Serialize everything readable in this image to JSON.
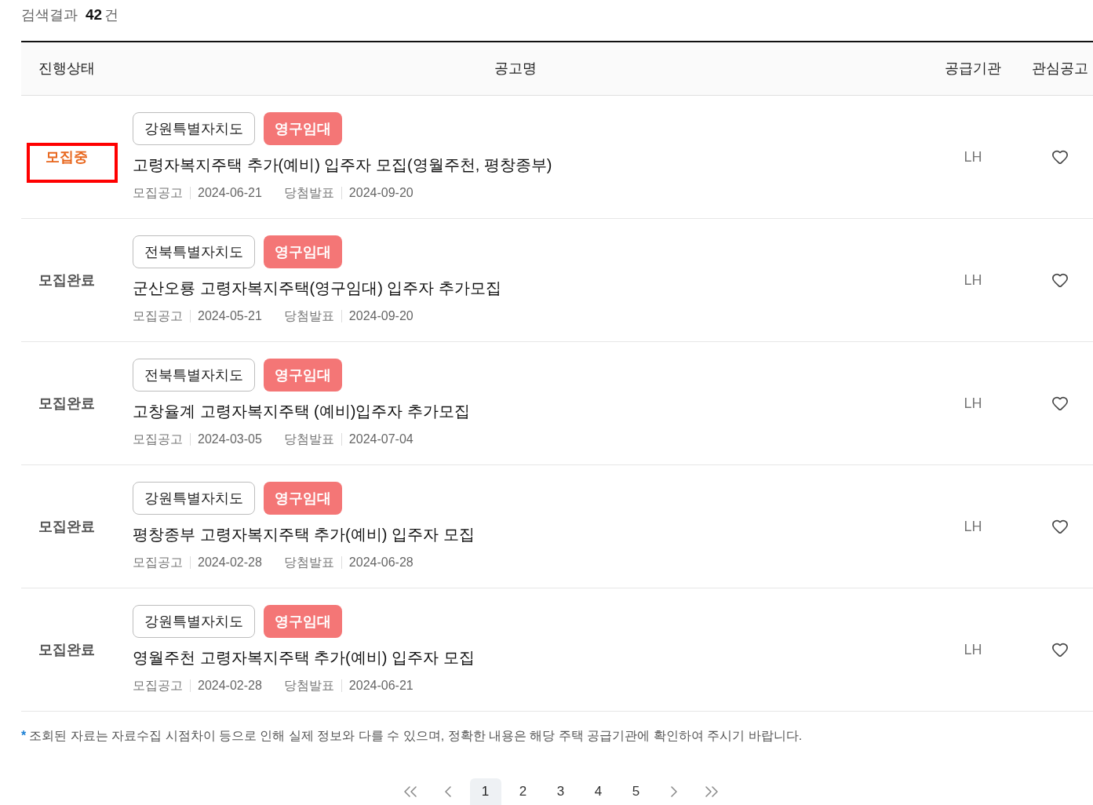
{
  "results": {
    "label": "검색결과",
    "count": "42",
    "unit": "건"
  },
  "table": {
    "columns": [
      "진행상태",
      "공고명",
      "공급기관",
      "관심공고"
    ],
    "rows": [
      {
        "status": "모집중",
        "recruiting": true,
        "highlighted": true,
        "tags": [
          {
            "kind": "region",
            "text": "강원특별자치도"
          },
          {
            "kind": "type",
            "text": "영구임대"
          }
        ],
        "title": "고령자복지주택 추가(예비) 입주자 모집(영월주천, 평창종부)",
        "dates": [
          {
            "label": "모집공고",
            "value": "2024-06-21"
          },
          {
            "label": "당첨발표",
            "value": "2024-09-20"
          }
        ],
        "supplier": "LH",
        "favorite": false
      },
      {
        "status": "모집완료",
        "recruiting": false,
        "highlighted": false,
        "tags": [
          {
            "kind": "region",
            "text": "전북특별자치도"
          },
          {
            "kind": "type",
            "text": "영구임대"
          }
        ],
        "title": "군산오룡 고령자복지주택(영구임대) 입주자 추가모집",
        "dates": [
          {
            "label": "모집공고",
            "value": "2024-05-21"
          },
          {
            "label": "당첨발표",
            "value": "2024-09-20"
          }
        ],
        "supplier": "LH",
        "favorite": false
      },
      {
        "status": "모집완료",
        "recruiting": false,
        "highlighted": false,
        "tags": [
          {
            "kind": "region",
            "text": "전북특별자치도"
          },
          {
            "kind": "type",
            "text": "영구임대"
          }
        ],
        "title": "고창율계 고령자복지주택 (예비)입주자 추가모집",
        "dates": [
          {
            "label": "모집공고",
            "value": "2024-03-05"
          },
          {
            "label": "당첨발표",
            "value": "2024-07-04"
          }
        ],
        "supplier": "LH",
        "favorite": false
      },
      {
        "status": "모집완료",
        "recruiting": false,
        "highlighted": false,
        "tags": [
          {
            "kind": "region",
            "text": "강원특별자치도"
          },
          {
            "kind": "type",
            "text": "영구임대"
          }
        ],
        "title": "평창종부 고령자복지주택 추가(예비) 입주자 모집",
        "dates": [
          {
            "label": "모집공고",
            "value": "2024-02-28"
          },
          {
            "label": "당첨발표",
            "value": "2024-06-28"
          }
        ],
        "supplier": "LH",
        "favorite": false
      },
      {
        "status": "모집완료",
        "recruiting": false,
        "highlighted": false,
        "tags": [
          {
            "kind": "region",
            "text": "강원특별자치도"
          },
          {
            "kind": "type",
            "text": "영구임대"
          }
        ],
        "title": "영월주천 고령자복지주택 추가(예비) 입주자 모집",
        "dates": [
          {
            "label": "모집공고",
            "value": "2024-02-28"
          },
          {
            "label": "당첨발표",
            "value": "2024-06-21"
          }
        ],
        "supplier": "LH",
        "favorite": false
      }
    ]
  },
  "note": {
    "mark": "*",
    "text": "조회된 자료는 자료수집 시점차이 등으로 인해 실제 정보와 다를 수 있으며, 정확한 내용은 해당 주택 공급기관에 확인하여 주시기 바랍니다."
  },
  "pagination": {
    "pages": [
      {
        "label": "1",
        "selected": true
      },
      {
        "label": "2",
        "selected": false
      },
      {
        "label": "3",
        "selected": false
      },
      {
        "label": "4",
        "selected": false
      },
      {
        "label": "5",
        "selected": false
      }
    ]
  }
}
